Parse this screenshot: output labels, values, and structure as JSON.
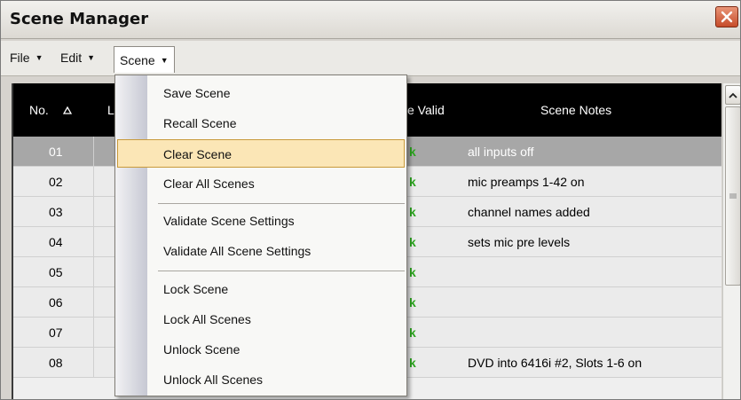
{
  "window": {
    "title": "Scene Manager"
  },
  "menubar": {
    "items": [
      {
        "label": "File"
      },
      {
        "label": "Edit"
      },
      {
        "label": "Scene"
      }
    ]
  },
  "table": {
    "columns": [
      "No.",
      "L",
      "e Valid",
      "Scene Notes"
    ],
    "rows": [
      {
        "no": "01",
        "valid": "k",
        "notes": "all inputs off"
      },
      {
        "no": "02",
        "valid": "k",
        "notes": "mic preamps 1-42 on"
      },
      {
        "no": "03",
        "valid": "k",
        "notes": "channel names added"
      },
      {
        "no": "04",
        "valid": "k",
        "notes": "sets mic pre levels"
      },
      {
        "no": "05",
        "valid": "k",
        "notes": ""
      },
      {
        "no": "06",
        "valid": "k",
        "notes": ""
      },
      {
        "no": "07",
        "valid": "k",
        "notes": ""
      },
      {
        "no": "08",
        "valid": "k",
        "notes": "DVD into 6416i #2, Slots 1-6 on"
      }
    ],
    "selected_row": "01"
  },
  "scene_menu": {
    "items": [
      {
        "label": "Save Scene"
      },
      {
        "label": "Recall Scene"
      },
      {
        "label": "Clear Scene"
      },
      {
        "label": "Clear All Scenes"
      },
      {
        "label": "Validate Scene Settings"
      },
      {
        "label": "Validate All Scene Settings"
      },
      {
        "label": "Lock Scene"
      },
      {
        "label": "Lock All Scenes"
      },
      {
        "label": "Unlock Scene"
      },
      {
        "label": "Unlock All Scenes"
      }
    ],
    "highlighted": "Clear Scene"
  },
  "colors": {
    "ok_green": "#2aa51d",
    "header_bg": "#000000",
    "selected_row_bg": "#a7a7a7",
    "highlight_bg": "#fbe6b6",
    "close_button_red": "#c64b2a"
  },
  "icons": [
    "close-icon",
    "sort-ascending-icon",
    "scroll-up-icon",
    "scroll-grip-icon",
    "chevron-down-icon"
  ]
}
